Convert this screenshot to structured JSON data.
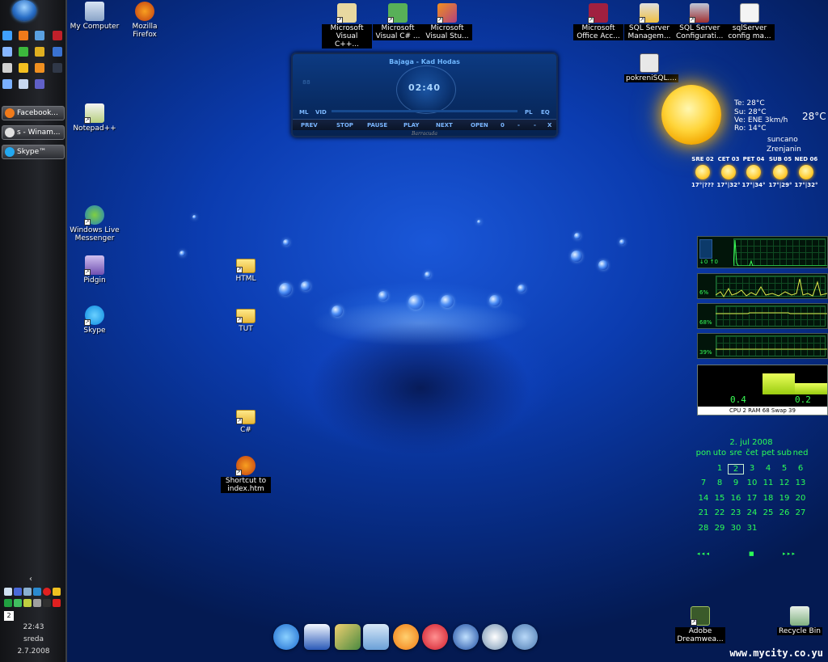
{
  "sidebar": {
    "tasks": [
      {
        "label": "Facebook..."
      },
      {
        "label": "s - Winam..."
      },
      {
        "label": "Skype™"
      }
    ],
    "tray_badge": "2",
    "clock": {
      "time": "22:43",
      "day": "sreda",
      "date": "2.7.2008"
    }
  },
  "desktop_icons": {
    "my_computer": "My Computer",
    "firefox": "Mozilla Firefox",
    "vcpp": "Microsoft Visual C++...",
    "vcsharp": "Microsoft Visual C# ...",
    "vstudio": "Microsoft Visual Stu...",
    "office_access": "Microsoft Office Acc...",
    "sql_mgmt": "SQL Server Managem...",
    "sql_config": "SQL Server Configurati...",
    "sqlserver_cfg": "sqlServer config ma...",
    "pokreni_sql": "pokreniSQL....",
    "notepadpp": "Notepad++",
    "wlm": "Windows Live Messenger",
    "pidgin": "Pidgin",
    "skype": "Skype",
    "html": "HTML",
    "tut": "TUT",
    "csharp": "C#",
    "shortcut_index": "Shortcut to index.htm",
    "dreamweaver": "Adobe Dreamwea...",
    "recycle": "Recycle Bin"
  },
  "winamp": {
    "title": "Bajaga - Kad Hodas",
    "time": "02:40",
    "ml": "ML",
    "vid": "VID",
    "pl": "PL",
    "eq": "EQ",
    "prev": "PREV",
    "stop": "STOP",
    "pause": "PAUSE",
    "play": "PLAY",
    "next": "NEXT",
    "open": "OPEN",
    "zero": "0",
    "minus": "-",
    "close": "X",
    "skin": "Barracuda"
  },
  "weather": {
    "temp_big": "28°C",
    "te": "Te: 28°C",
    "su": "Su: 28°C",
    "ve": "Ve: ENE 3km/h",
    "ro": "Ro: 14°C",
    "condition": "suncano",
    "city": "Zrenjanin",
    "forecast": [
      {
        "day": "SRE 02",
        "temp": "17°|???"
      },
      {
        "day": "CET 03",
        "temp": "17°|32°"
      },
      {
        "day": "PET 04",
        "temp": "17°|34°"
      },
      {
        "day": "SUB 05",
        "temp": "17°|29°"
      },
      {
        "day": "NED 06",
        "temp": "17°|32°"
      }
    ]
  },
  "meters": {
    "net_down": "0",
    "net_up": "0",
    "cpu1": "6%",
    "ram": "68%",
    "swap": "39%",
    "digit_left": "0.4",
    "digit_right": "0.2",
    "caption": "CPU 2  RAM 68  Swap 39"
  },
  "calendar": {
    "title": "2. jul 2008",
    "headers": [
      "pon",
      "uto",
      "sre",
      "čet",
      "pet",
      "sub",
      "ned"
    ],
    "weeks": [
      [
        "",
        "1",
        "2",
        "3",
        "4",
        "5",
        "6"
      ],
      [
        "7",
        "8",
        "9",
        "10",
        "11",
        "12",
        "13"
      ],
      [
        "14",
        "15",
        "16",
        "17",
        "18",
        "19",
        "20"
      ],
      [
        "21",
        "22",
        "23",
        "24",
        "25",
        "26",
        "27"
      ],
      [
        "28",
        "29",
        "30",
        "31",
        "",
        "",
        ""
      ]
    ],
    "nav_prev": "◂ ◂  ◂",
    "nav_today": "■",
    "nav_next": "▸  ▸ ▸"
  },
  "dock": [
    "internet-explorer-icon",
    "word-icon",
    "paint-icon",
    "finder-icon",
    "vlc-icon",
    "lastfm-icon",
    "globe-icon",
    "fan-icon",
    "network-icon"
  ],
  "watermark": "www.mycity.co.yu",
  "colors": {
    "accent_green": "#2cff56",
    "wallpaper_blue": "#0b3cb0"
  }
}
